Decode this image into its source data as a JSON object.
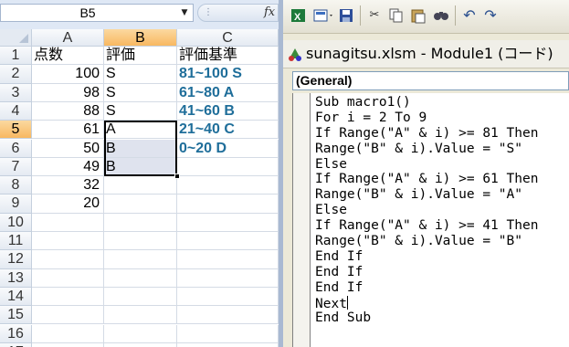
{
  "excel": {
    "name_box": "B5",
    "formula_icon": "fx",
    "columns": [
      "A",
      "B",
      "C"
    ],
    "rows": [
      "1",
      "2",
      "3",
      "4",
      "5",
      "6",
      "7",
      "8",
      "9",
      "10",
      "11",
      "12",
      "13",
      "14",
      "15",
      "16",
      "17"
    ],
    "headers": {
      "A": "点数",
      "B": "評価",
      "C": "評価基準"
    },
    "scores": [
      "100",
      "98",
      "88",
      "61",
      "50",
      "49",
      "32",
      "20"
    ],
    "grades": [
      "S",
      "S",
      "S",
      "A",
      "B",
      "B"
    ],
    "criteria": [
      "81~100 S",
      "61~80 A",
      "41~60 B",
      "21~40 C",
      "0~20 D"
    ],
    "active_cell": "B5",
    "active_row": "5",
    "active_column": "B"
  },
  "vbe": {
    "window_title": "sunagitsu.xlsm - Module1 (コード)",
    "procedure_combo": "(General)",
    "code_lines": [
      "Sub macro1()",
      "For i = 2 To 9",
      "If Range(\"A\" & i) >= 81 Then",
      "Range(\"B\" & i).Value = \"S\"",
      "Else",
      "If Range(\"A\" & i) >= 61 Then",
      "Range(\"B\" & i).Value = \"A\"",
      "Else",
      "If Range(\"A\" & i) >= 41 Then",
      "Range(\"B\" & i).Value = \"B\"",
      "End If",
      "End If",
      "End If",
      "Next",
      "End Sub"
    ]
  }
}
